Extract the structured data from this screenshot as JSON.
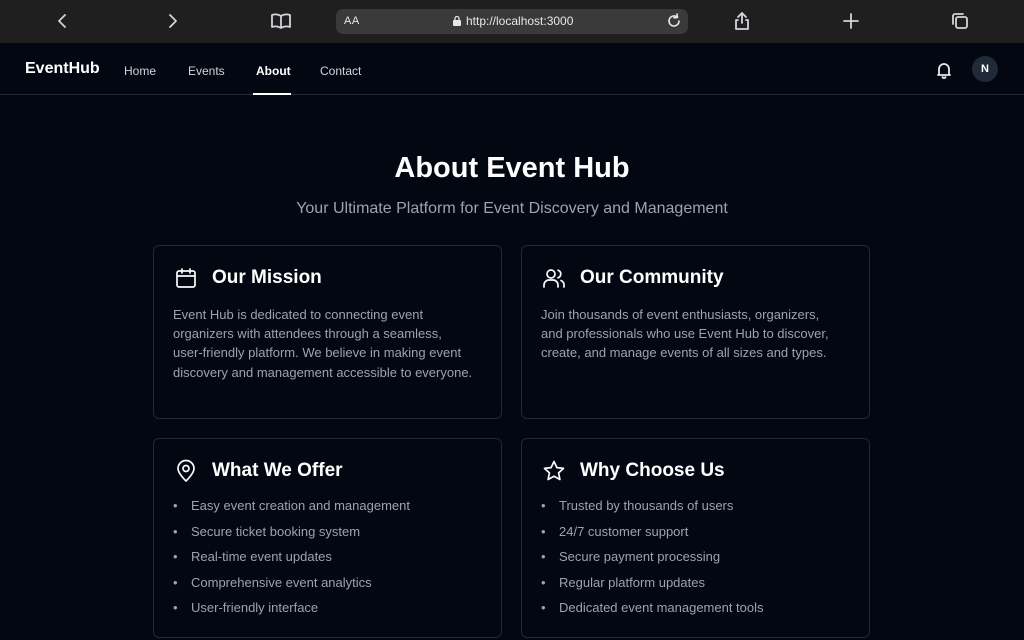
{
  "browser": {
    "text_size": "AA",
    "url": "http://localhost:3000"
  },
  "header": {
    "brand": "EventHub",
    "nav": [
      {
        "label": "Home"
      },
      {
        "label": "Events"
      },
      {
        "label": "About"
      },
      {
        "label": "Contact"
      }
    ],
    "active_nav": "About",
    "avatar_initial": "N"
  },
  "main": {
    "title": "About Event Hub",
    "subtitle": "Your Ultimate Platform for Event Discovery and Management",
    "mission": {
      "icon": "calendar-icon",
      "heading": "Our Mission",
      "body": "Event Hub is dedicated to connecting event organizers with attendees through a seamless, user-friendly platform. We believe in making event discovery and management accessible to everyone."
    },
    "community": {
      "icon": "users-icon",
      "heading": "Our Community",
      "body": "Join thousands of event enthusiasts, organizers, and professionals who use Event Hub to discover, create, and manage events of all sizes and types."
    },
    "offer": {
      "icon": "map-pin-icon",
      "heading": "What We Offer",
      "items": [
        "Easy event creation and management",
        "Secure ticket booking system",
        "Real-time event updates",
        "Comprehensive event analytics",
        "User-friendly interface"
      ]
    },
    "why": {
      "icon": "star-icon",
      "heading": "Why Choose Us",
      "items": [
        "Trusted by thousands of users",
        "24/7 customer support",
        "Secure payment processing",
        "Regular platform updates",
        "Dedicated event management tools"
      ]
    }
  },
  "colors": {
    "background": "#030712",
    "border": "#1f2937",
    "text_muted": "#9ca3af",
    "text_primary": "#ffffff"
  }
}
